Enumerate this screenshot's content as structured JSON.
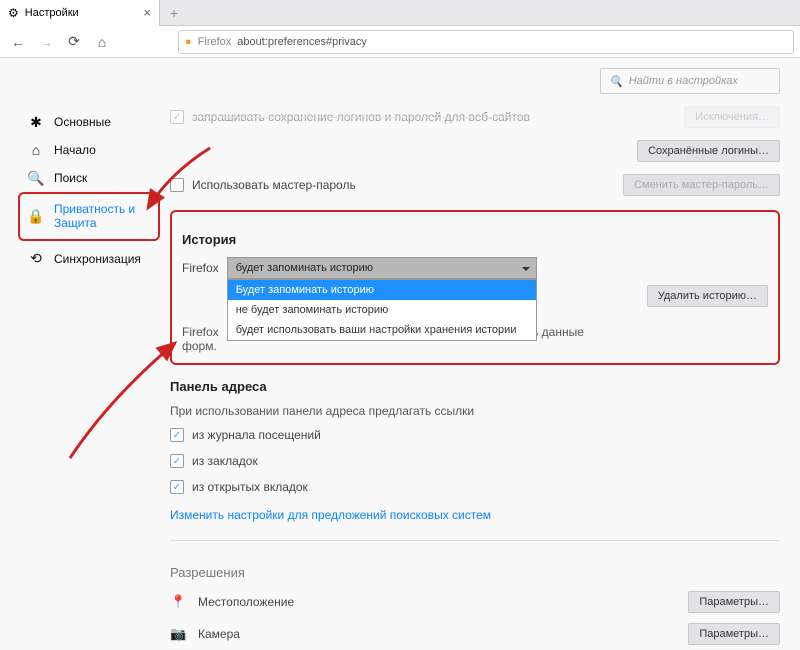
{
  "tab": {
    "title": "Настройки"
  },
  "urlbar": {
    "brand": "Firefox",
    "url": "about:preferences#privacy"
  },
  "search": {
    "placeholder": "Найти в настройках"
  },
  "sidebar": {
    "items": [
      {
        "label": "Основные"
      },
      {
        "label": "Начало"
      },
      {
        "label": "Поиск"
      },
      {
        "label": "Приватность и\nЗащита"
      },
      {
        "label": "Синхронизация"
      }
    ]
  },
  "logins": {
    "truncated": "запрашивать сохранение логинов и паролей для веб-сайтов",
    "btn_exceptions": "Исключения…",
    "btn_saved": "Сохранённые логины…",
    "master_label": "Использовать мастер-пароль",
    "btn_master": "Сменить мастер-пароль…"
  },
  "history": {
    "title": "История",
    "select_label": "Firefox",
    "current": "будет запоминать историю",
    "options": [
      "Будет запоминать историю",
      "не будет запоминать историю",
      "будет использовать ваши настройки хранения истории"
    ],
    "note": "Firefox будет помнить историю посещений, загрузок, поиска и сохранять данные форм.",
    "note_short": "ь данные",
    "btn_clear": "Удалить историю…"
  },
  "addressbar": {
    "title": "Панель адреса",
    "subtitle": "При использовании панели адреса предлагать ссылки",
    "opts": [
      "из журнала посещений",
      "из закладок",
      "из открытых вкладок"
    ],
    "link": "Изменить настройки для предложений поисковых систем"
  },
  "permissions": {
    "title": "Разрешения",
    "rows": [
      {
        "label": "Местоположение",
        "btn": "Параметры…"
      },
      {
        "label": "Камера",
        "btn": "Параметры…"
      }
    ]
  }
}
